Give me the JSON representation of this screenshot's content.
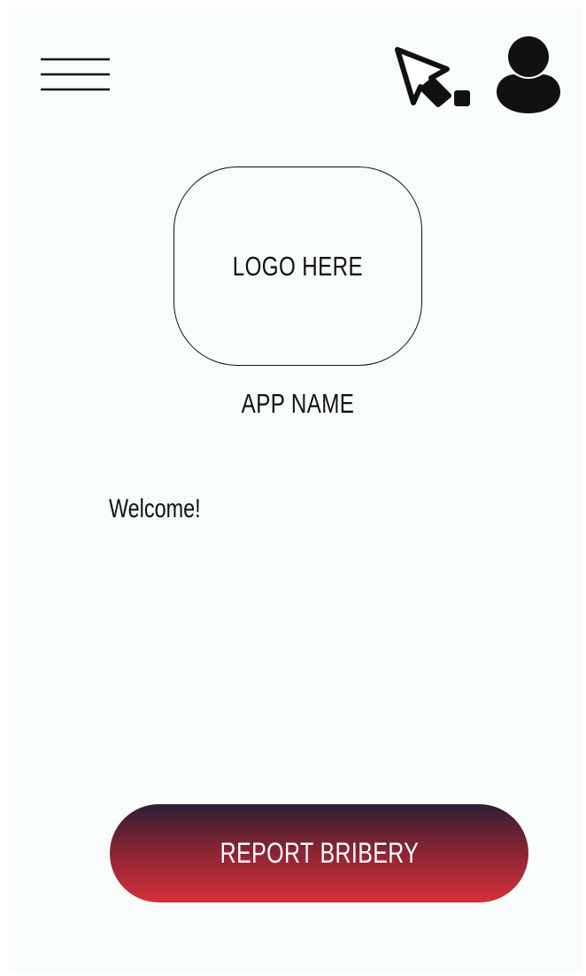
{
  "header": {
    "menu_icon": "hamburger-menu-icon",
    "pointer_icon": "cursor-pointer-icon",
    "user_icon": "user-profile-icon"
  },
  "logo": {
    "placeholder_text": "LOGO HERE"
  },
  "app": {
    "name": "APP NAME"
  },
  "main": {
    "welcome_text": "Welcome!"
  },
  "actions": {
    "report_button_label": "REPORT BRIBERY"
  },
  "colors": {
    "background": "#f8fcfb",
    "button_gradient_top": "#2f1e33",
    "button_gradient_mid": "#8a2435",
    "button_gradient_bottom": "#d5303a",
    "button_text": "#ffffff"
  }
}
